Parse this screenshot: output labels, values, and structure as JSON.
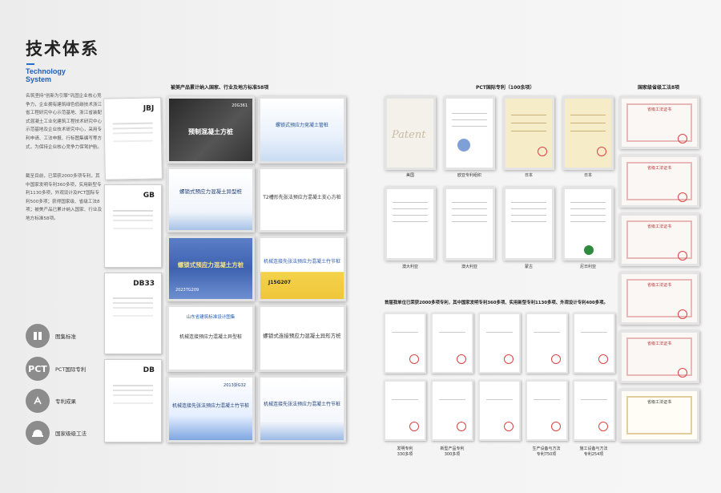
{
  "page": {
    "title": "技术体系",
    "title_en_line1": "Technology",
    "title_en_line2": "System",
    "intro_para1": "名筑坚持\"创新为引擎\"巩固企业核心竞争力，企业拥有建筑绿色低碳技术浙江省工程研究中心示范基地、浙江省装配式混凝土工业化建筑工程技术研究中心示范基地及企业技术研究中心，采用专利申请、工法申报、行标图集编写等方式，为保持企业核心竞争力保驾护航。",
    "intro_para2": "截至目前，已荣获2000多项专利，其中国家发明专利360多项，实用新型专利1130多项，外观设计及PCT国际专利500多项；获得国家级、省级工法8项；被美产品已累计纳入国家、行业及地方标准58项。"
  },
  "legend": [
    {
      "icon": "book-icon",
      "glyph": "",
      "label": "图集标准"
    },
    {
      "icon": "pct-icon",
      "glyph": "PCT",
      "label": "PCT国际专利"
    },
    {
      "icon": "patent-icon",
      "glyph": "",
      "label": "专利成果"
    },
    {
      "icon": "helmet-icon",
      "glyph": "",
      "label": "国家级级工法"
    }
  ],
  "sections": {
    "standards_heading": "被美产品累计纳入国家、行业及地方标准58项",
    "pct_heading": "PCT国际专利（100余项）",
    "gongfa_heading": "国家级省级工法8项",
    "patents_heading": "首届我单位已荣获2000多项专利，其中国家发明专利360多项、实用新型专利1130多项、外观设计专利400多项。"
  },
  "standard_codes": [
    "JBJ",
    "GB",
    "DB33",
    "DB"
  ],
  "docs": [
    {
      "title": "预制混凝土方桩",
      "code": "20G361"
    },
    {
      "title": "螺锁式预应力竞凝土管桩",
      "code": ""
    },
    {
      "title": "螺锁式预应力混凝土异型桩",
      "code": ""
    },
    {
      "title": "T2槽形先张法预应力混凝土支心方桩",
      "code": ""
    },
    {
      "title": "螺锁式预应力混凝土方桩",
      "code": "2023TG209"
    },
    {
      "title": "机械连接先张法预应力混凝土竹节桩",
      "code": "J15G207"
    },
    {
      "title": "机械连接预应力混凝土异型桩",
      "code": "山东省建筑标准设计图集"
    },
    {
      "title": "螺锁式连接预应力混凝土异形方桩",
      "code": ""
    },
    {
      "title": "机械连接先张法预应力混凝土竹节桩",
      "code": "2013浙G32"
    },
    {
      "title": "机械连接先张法预应力混凝土竹节桩",
      "code": ""
    }
  ],
  "pct_row1": [
    {
      "caption": "美国"
    },
    {
      "caption": "欧亚专利组织"
    },
    {
      "caption": "日本"
    },
    {
      "caption": "日本"
    }
  ],
  "pct_row2": [
    {
      "caption": "澳大利亚"
    },
    {
      "caption": "澳大利亚"
    },
    {
      "caption": "蒙古"
    },
    {
      "caption": "尼日利亚"
    }
  ],
  "gongfa_cert_title": "省级工法证书",
  "patent_captions": [
    {
      "line1": "发明专利",
      "line2": "330多项"
    },
    {
      "line1": "新型产品专利",
      "line2": "300多项"
    },
    {
      "line1": "生产设备与方法",
      "line2": "专利750项"
    },
    {
      "line1": "施工设备与方法",
      "line2": "专利254项"
    }
  ],
  "colors": {
    "accent": "#1f6fd1",
    "legend_circle": "#8c8c8c",
    "seal_red": "#d44444"
  }
}
